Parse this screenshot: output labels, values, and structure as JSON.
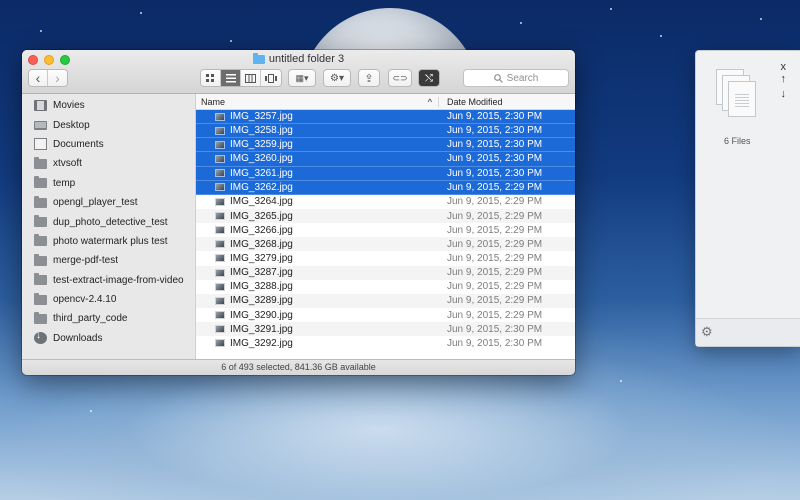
{
  "window": {
    "title": "untitled folder 3",
    "status": "6 of 493 selected, 841.36 GB available"
  },
  "toolbar": {
    "back_glyph": "‹",
    "forward_glyph": "›",
    "search_placeholder": "Search",
    "view_modes": [
      "icon-view",
      "list-view",
      "column-view",
      "cover-flow-view"
    ],
    "arrange_glyph": "▦▾",
    "action_glyph": "⚙▾",
    "share_glyph": "⇪",
    "tag_glyph": "⊂⊃",
    "app_glyph": "⤭"
  },
  "sidebar": {
    "items": [
      {
        "label": "Movies",
        "icon": "movies-icon"
      },
      {
        "label": "Desktop",
        "icon": "desktop-icon"
      },
      {
        "label": "Documents",
        "icon": "documents-icon"
      },
      {
        "label": "xtvsoft",
        "icon": "folder-icon"
      },
      {
        "label": "temp",
        "icon": "folder-icon"
      },
      {
        "label": "opengl_player_test",
        "icon": "folder-icon"
      },
      {
        "label": "dup_photo_detective_test",
        "icon": "folder-icon"
      },
      {
        "label": "photo watermark plus test",
        "icon": "folder-icon"
      },
      {
        "label": "merge-pdf-test",
        "icon": "folder-icon"
      },
      {
        "label": "test-extract-image-from-video",
        "icon": "folder-icon"
      },
      {
        "label": "opencv-2.4.10",
        "icon": "folder-icon"
      },
      {
        "label": "third_party_code",
        "icon": "folder-icon"
      },
      {
        "label": "Downloads",
        "icon": "downloads-icon"
      }
    ]
  },
  "list": {
    "columns": {
      "name": "Name",
      "sort_glyph": "^",
      "date": "Date Modified"
    },
    "rows": [
      {
        "name": "IMG_3257.jpg",
        "date": "Jun 9, 2015, 2:30 PM",
        "selected": true
      },
      {
        "name": "IMG_3258.jpg",
        "date": "Jun 9, 2015, 2:30 PM",
        "selected": true
      },
      {
        "name": "IMG_3259.jpg",
        "date": "Jun 9, 2015, 2:30 PM",
        "selected": true
      },
      {
        "name": "IMG_3260.jpg",
        "date": "Jun 9, 2015, 2:30 PM",
        "selected": true
      },
      {
        "name": "IMG_3261.jpg",
        "date": "Jun 9, 2015, 2:30 PM",
        "selected": true
      },
      {
        "name": "IMG_3262.jpg",
        "date": "Jun 9, 2015, 2:29 PM",
        "selected": true
      },
      {
        "name": "IMG_3264.jpg",
        "date": "Jun 9, 2015, 2:29 PM",
        "selected": false
      },
      {
        "name": "IMG_3265.jpg",
        "date": "Jun 9, 2015, 2:29 PM",
        "selected": false
      },
      {
        "name": "IMG_3266.jpg",
        "date": "Jun 9, 2015, 2:29 PM",
        "selected": false
      },
      {
        "name": "IMG_3268.jpg",
        "date": "Jun 9, 2015, 2:29 PM",
        "selected": false
      },
      {
        "name": "IMG_3279.jpg",
        "date": "Jun 9, 2015, 2:29 PM",
        "selected": false
      },
      {
        "name": "IMG_3287.jpg",
        "date": "Jun 9, 2015, 2:29 PM",
        "selected": false
      },
      {
        "name": "IMG_3288.jpg",
        "date": "Jun 9, 2015, 2:29 PM",
        "selected": false
      },
      {
        "name": "IMG_3289.jpg",
        "date": "Jun 9, 2015, 2:29 PM",
        "selected": false
      },
      {
        "name": "IMG_3290.jpg",
        "date": "Jun 9, 2015, 2:29 PM",
        "selected": false
      },
      {
        "name": "IMG_3291.jpg",
        "date": "Jun 9, 2015, 2:30 PM",
        "selected": false
      },
      {
        "name": "IMG_3292.jpg",
        "date": "Jun 9, 2015, 2:30 PM",
        "selected": false
      }
    ]
  },
  "panel": {
    "count": "6 Files",
    "close_glyph": "x",
    "up_glyph": "↑",
    "down_glyph": "↓",
    "gear_glyph": "⚙"
  },
  "colors": {
    "selection": "#1c6ad7",
    "folder_accent": "#5fb3ee"
  }
}
